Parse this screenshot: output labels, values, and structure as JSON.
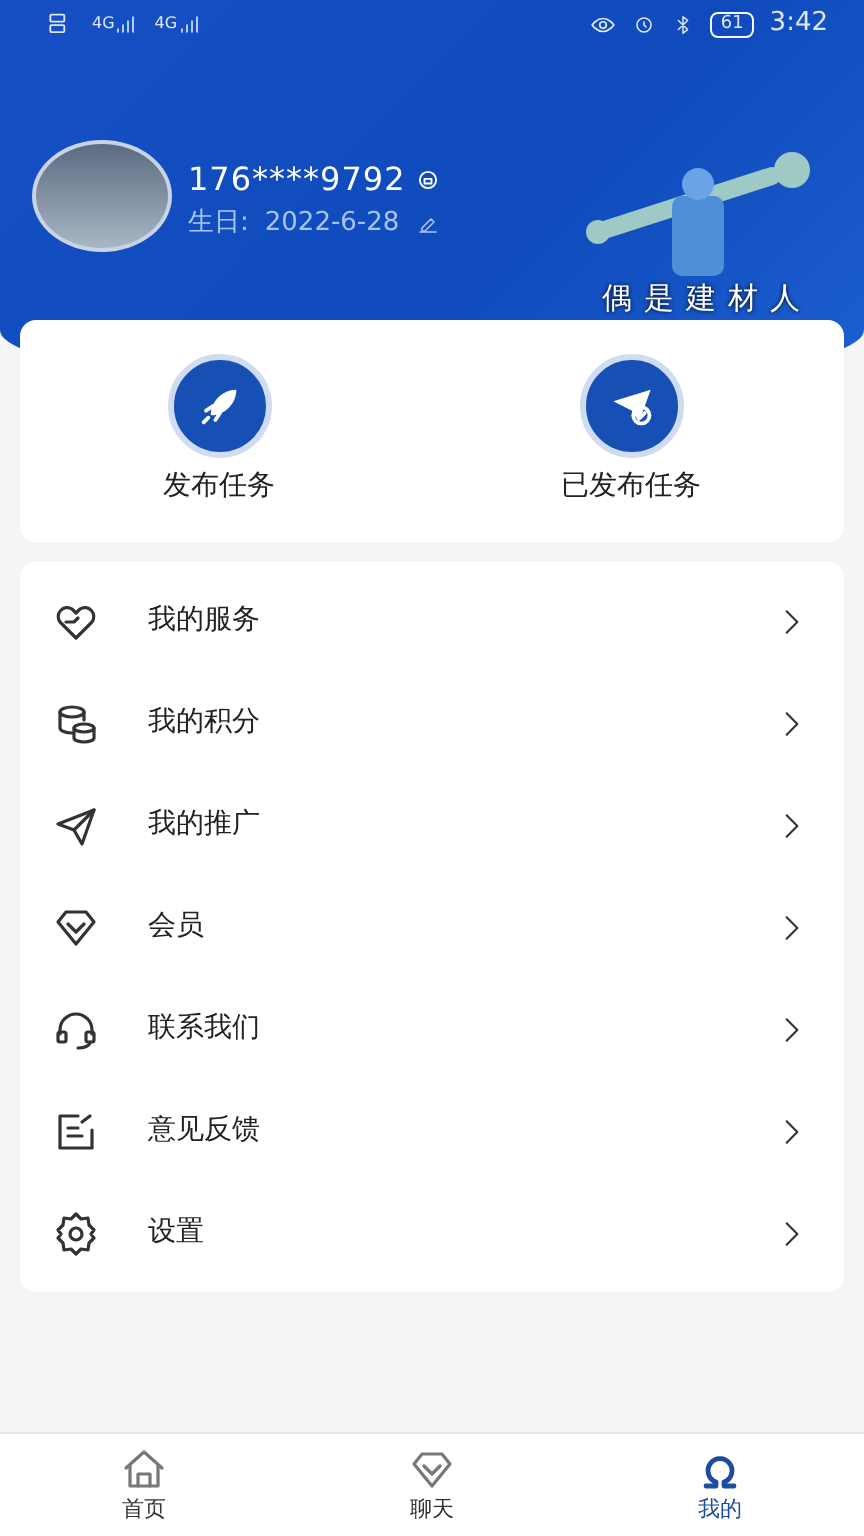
{
  "status_bar": {
    "network": [
      "4G",
      "4G"
    ],
    "battery": "61",
    "time": "3:42"
  },
  "profile": {
    "phone": "176****9792",
    "birthday_label": "生日:",
    "birthday": "2022-6-28",
    "banner_caption": "偶是建材人"
  },
  "actions": [
    {
      "kind": "rocket",
      "label": "发布任务"
    },
    {
      "kind": "plane",
      "label": "已发布任务"
    }
  ],
  "menu": [
    {
      "kind": "heart",
      "label": "我的服务"
    },
    {
      "kind": "coins",
      "label": "我的积分"
    },
    {
      "kind": "send",
      "label": "我的推广"
    },
    {
      "kind": "diamond",
      "label": "会员"
    },
    {
      "kind": "headset",
      "label": "联系我们"
    },
    {
      "kind": "note",
      "label": "意见反馈"
    },
    {
      "kind": "gear",
      "label": "设置"
    }
  ],
  "tabs": [
    {
      "kind": "home",
      "label": "首页",
      "selected": false
    },
    {
      "kind": "chat",
      "label": "聊天",
      "selected": false
    },
    {
      "kind": "me",
      "label": "我的",
      "selected": true
    }
  ]
}
